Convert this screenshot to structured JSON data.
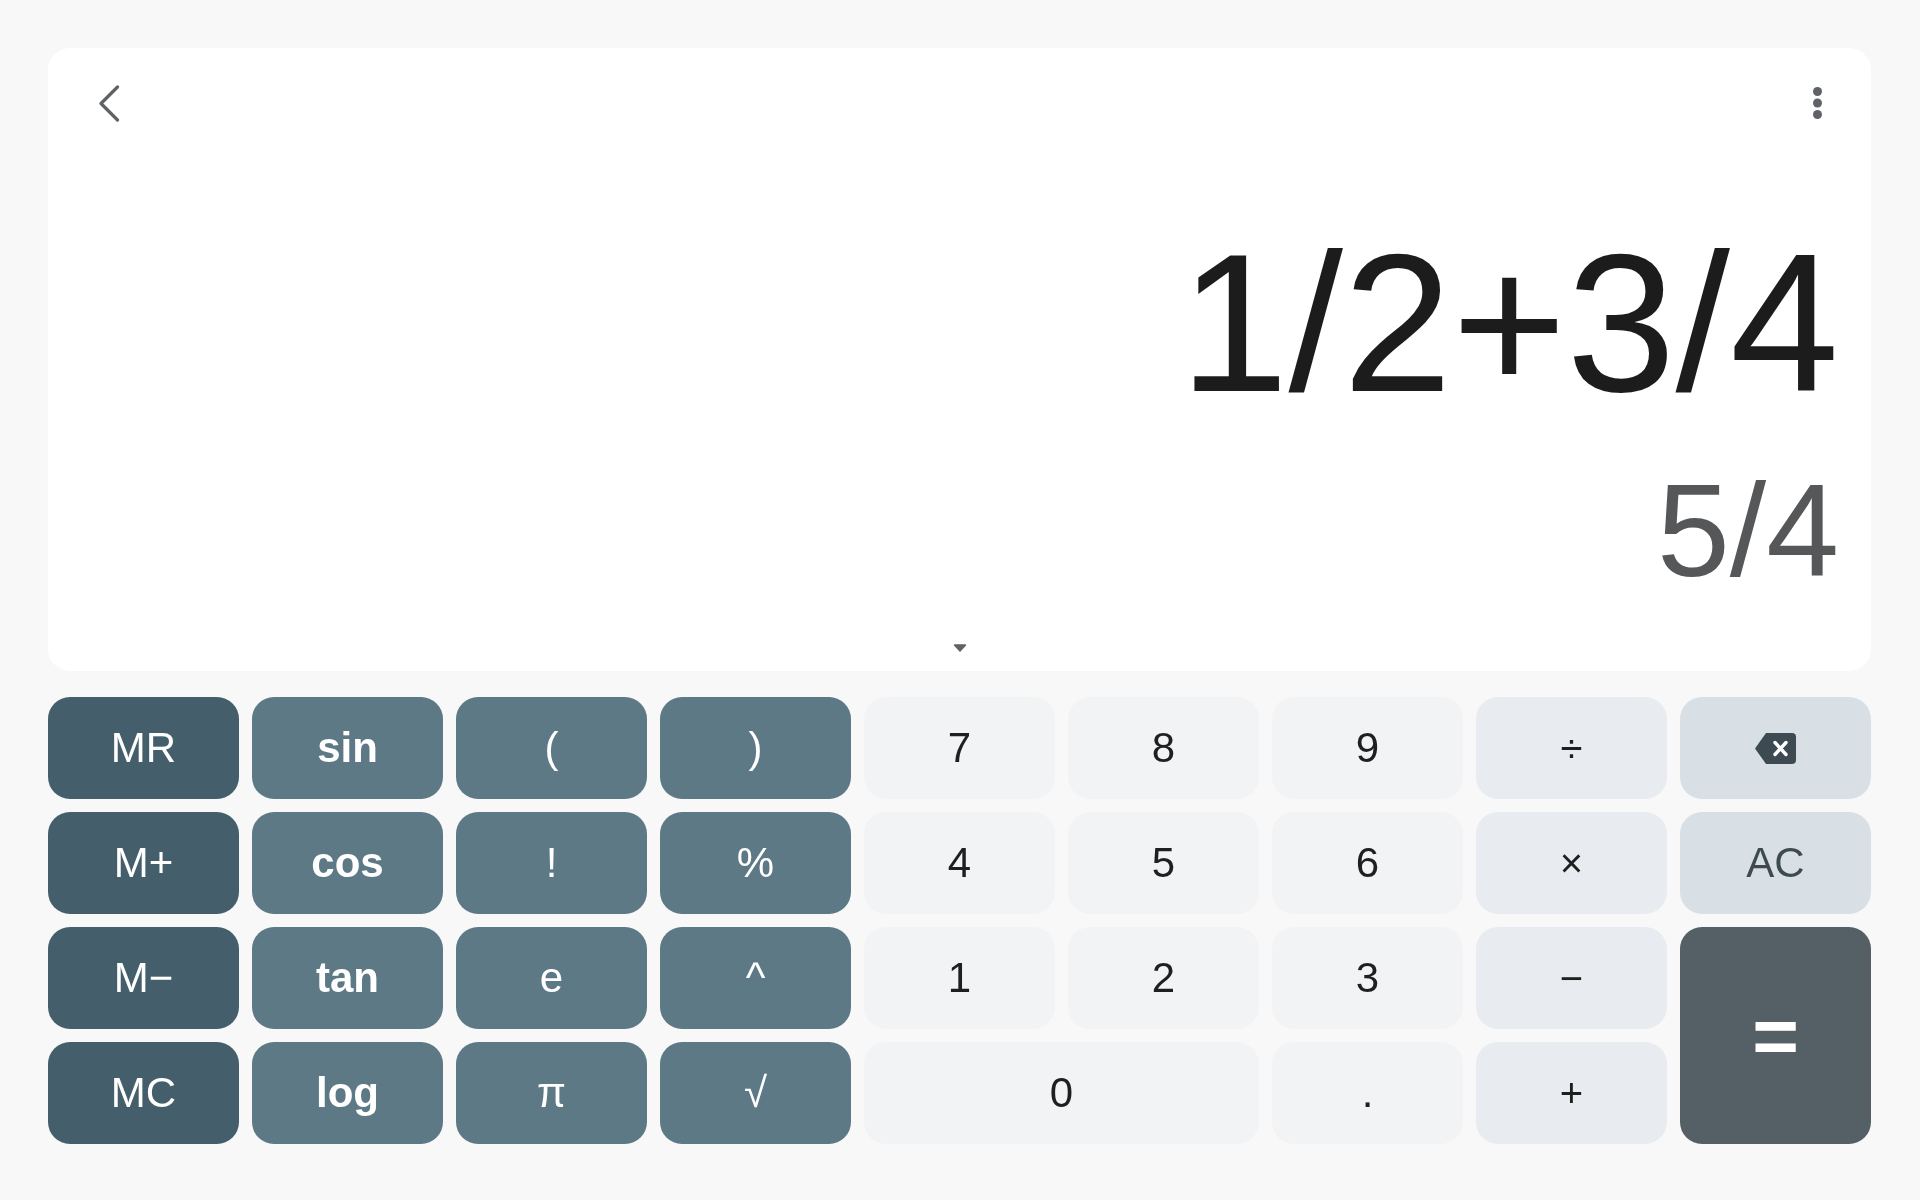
{
  "display": {
    "expression": "1/2+3/4",
    "result": "5/4"
  },
  "keypad": {
    "keys": [
      {
        "label": "MR",
        "kind": "memory"
      },
      {
        "label": "sin",
        "kind": "function"
      },
      {
        "label": "(",
        "kind": "symbol"
      },
      {
        "label": ")",
        "kind": "symbol"
      },
      {
        "label": "7",
        "kind": "digit"
      },
      {
        "label": "8",
        "kind": "digit"
      },
      {
        "label": "9",
        "kind": "digit"
      },
      {
        "label": "÷",
        "kind": "operator"
      },
      {
        "kind": "backspace"
      },
      {
        "label": "M+",
        "kind": "memory"
      },
      {
        "label": "cos",
        "kind": "function"
      },
      {
        "label": "!",
        "kind": "symbol"
      },
      {
        "label": "%",
        "kind": "symbol"
      },
      {
        "label": "4",
        "kind": "digit"
      },
      {
        "label": "5",
        "kind": "digit"
      },
      {
        "label": "6",
        "kind": "digit"
      },
      {
        "label": "×",
        "kind": "operator"
      },
      {
        "label": "AC",
        "kind": "clear"
      },
      {
        "label": "M−",
        "kind": "memory"
      },
      {
        "label": "tan",
        "kind": "function"
      },
      {
        "label": "e",
        "kind": "symbol"
      },
      {
        "label": "^",
        "kind": "symbol"
      },
      {
        "label": "1",
        "kind": "digit"
      },
      {
        "label": "2",
        "kind": "digit"
      },
      {
        "label": "3",
        "kind": "digit"
      },
      {
        "label": "−",
        "kind": "operator"
      },
      {
        "label": "=",
        "kind": "equals"
      },
      {
        "label": "MC",
        "kind": "memory"
      },
      {
        "label": "log",
        "kind": "function"
      },
      {
        "label": "π",
        "kind": "symbol"
      },
      {
        "label": "√",
        "kind": "symbol"
      },
      {
        "label": "0",
        "kind": "wide"
      },
      {
        "label": ".",
        "kind": "digit"
      },
      {
        "label": "+",
        "kind": "operator"
      }
    ]
  }
}
